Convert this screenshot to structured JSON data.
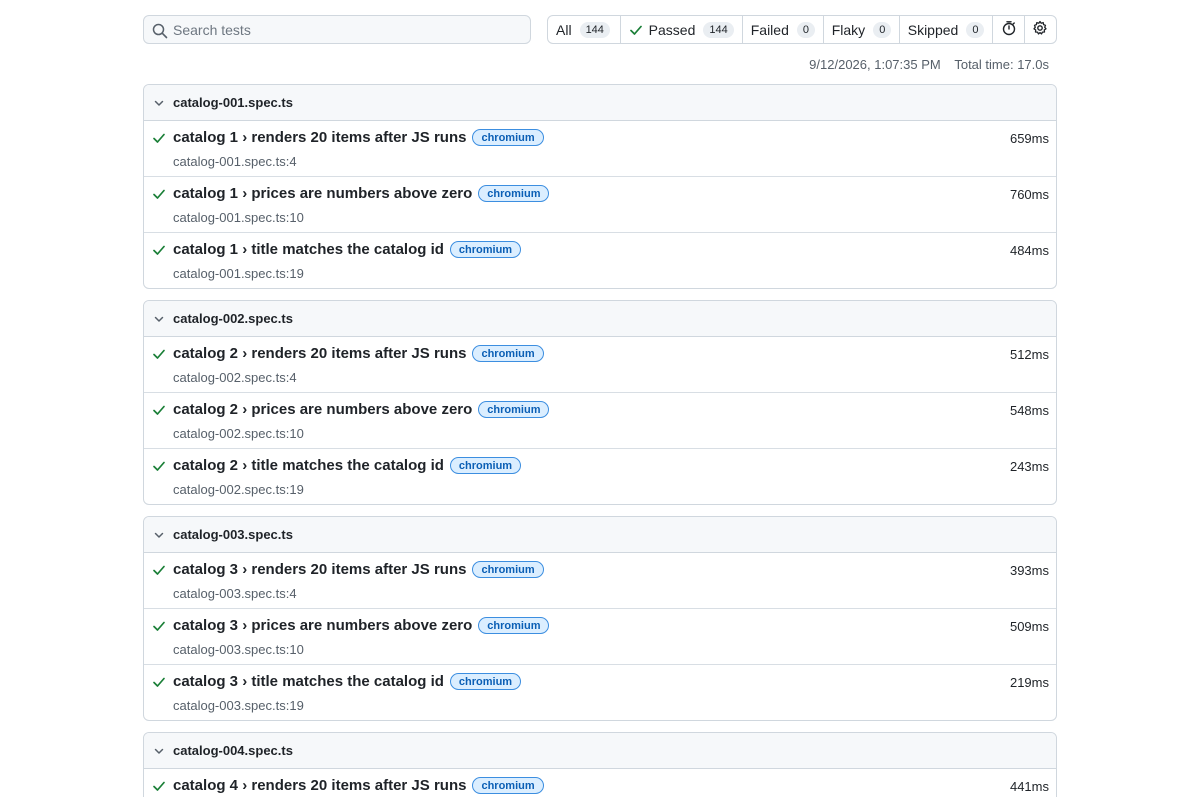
{
  "search": {
    "placeholder": "Search tests"
  },
  "filters": [
    {
      "label": "All",
      "count": "144"
    },
    {
      "label": "Passed",
      "count": "144"
    },
    {
      "label": "Failed",
      "count": "0"
    },
    {
      "label": "Flaky",
      "count": "0"
    },
    {
      "label": "Skipped",
      "count": "0"
    }
  ],
  "meta": {
    "datetime": "9/12/2026, 1:07:35 PM",
    "total_time": "Total time: 17.0s"
  },
  "colors": {
    "pass": "#1a7f37",
    "badge_text": "#0b5fb5",
    "badge_bg": "#dbeeff",
    "border": "#d0d7de"
  },
  "groups": [
    {
      "file": "catalog-001.spec.ts",
      "tests": [
        {
          "title": "catalog 1 › renders 20 items after JS runs",
          "project": "chromium",
          "location": "catalog-001.spec.ts:4",
          "duration": "659ms"
        },
        {
          "title": "catalog 1 › prices are numbers above zero",
          "project": "chromium",
          "location": "catalog-001.spec.ts:10",
          "duration": "760ms"
        },
        {
          "title": "catalog 1 › title matches the catalog id",
          "project": "chromium",
          "location": "catalog-001.spec.ts:19",
          "duration": "484ms"
        }
      ]
    },
    {
      "file": "catalog-002.spec.ts",
      "tests": [
        {
          "title": "catalog 2 › renders 20 items after JS runs",
          "project": "chromium",
          "location": "catalog-002.spec.ts:4",
          "duration": "512ms"
        },
        {
          "title": "catalog 2 › prices are numbers above zero",
          "project": "chromium",
          "location": "catalog-002.spec.ts:10",
          "duration": "548ms"
        },
        {
          "title": "catalog 2 › title matches the catalog id",
          "project": "chromium",
          "location": "catalog-002.spec.ts:19",
          "duration": "243ms"
        }
      ]
    },
    {
      "file": "catalog-003.spec.ts",
      "tests": [
        {
          "title": "catalog 3 › renders 20 items after JS runs",
          "project": "chromium",
          "location": "catalog-003.spec.ts:4",
          "duration": "393ms"
        },
        {
          "title": "catalog 3 › prices are numbers above zero",
          "project": "chromium",
          "location": "catalog-003.spec.ts:10",
          "duration": "509ms"
        },
        {
          "title": "catalog 3 › title matches the catalog id",
          "project": "chromium",
          "location": "catalog-003.spec.ts:19",
          "duration": "219ms"
        }
      ]
    },
    {
      "file": "catalog-004.spec.ts",
      "tests": [
        {
          "title": "catalog 4 › renders 20 items after JS runs",
          "project": "chromium",
          "duration": "441ms"
        }
      ]
    }
  ]
}
